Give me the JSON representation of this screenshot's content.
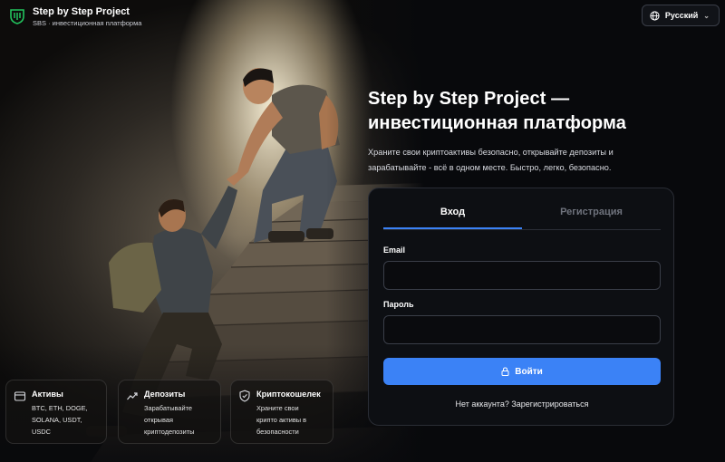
{
  "header": {
    "brand_title": "Step by Step Project",
    "brand_subtitle": "SBS · инвестиционная платформа",
    "language": "Русский",
    "icons": {
      "logo": "shield-logo-icon",
      "language": "globe-icon",
      "dropdown": "chevron-down-icon"
    }
  },
  "intro": {
    "heading_line1": "Step by Step Project —",
    "heading_line2": "инвестиционная платформа",
    "text_line1": "Храните свои криптоактивы безопасно, открывайте депозиты и",
    "text_line2": "зарабатывайте - всё в одном месте. Быстро, легко, безопасно."
  },
  "auth": {
    "tab_login": "Вход",
    "tab_register": "Регистрация",
    "active_tab": "login",
    "email_label": "Email",
    "email_value": "",
    "password_label": "Пароль",
    "password_value": "",
    "submit_label": "Войти",
    "submit_icon": "lock-icon",
    "footer_text": "Нет аккаунта?",
    "footer_link": "Зарегистрироваться"
  },
  "features": [
    {
      "title": "Активы",
      "lines": [
        "BTC, ETH, DOGE,",
        "SOLANA, USDT,",
        "USDC"
      ],
      "icon": "wallet-icon"
    },
    {
      "title": "Депозиты",
      "lines": [
        "Зарабатывайте",
        "открывая",
        "криптодепозиты"
      ],
      "icon": "trend-up-icon"
    },
    {
      "title": "Криптокошелек",
      "lines": [
        "Храните свои",
        "крипто активы в",
        "безопасности"
      ],
      "icon": "shield-check-icon"
    }
  ],
  "colors": {
    "accent": "#3b82f6",
    "background": "#08090c",
    "card": "#0d0f13",
    "logo": "#22c55e"
  }
}
